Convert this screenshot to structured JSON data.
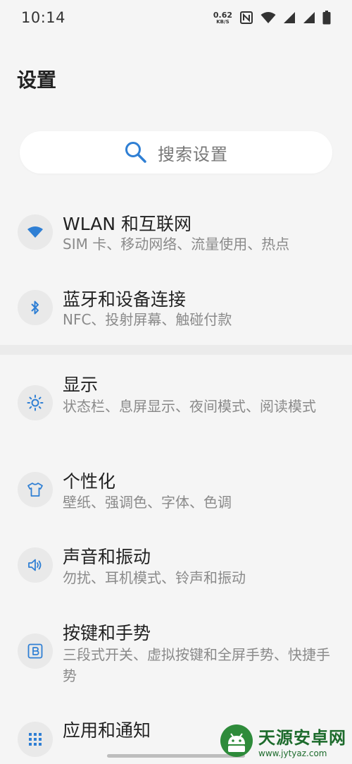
{
  "status_bar": {
    "time": "10:14",
    "net_speed_value": "0.62",
    "net_speed_unit": "KB/S",
    "icons": [
      "nfc-icon",
      "wifi-icon",
      "signal-icon",
      "signal-icon",
      "battery-icon"
    ]
  },
  "page": {
    "title": "设置"
  },
  "search": {
    "placeholder": "搜索设置"
  },
  "items": [
    {
      "title": "WLAN 和互联网",
      "subtitle": "SIM 卡、移动网络、流量使用、热点",
      "icon": "wifi-icon"
    },
    {
      "title": "蓝牙和设备连接",
      "subtitle": "NFC、投射屏幕、触碰付款",
      "icon": "bluetooth-icon"
    },
    {
      "title": "显示",
      "subtitle": "状态栏、息屏显示、夜间模式、阅读模式",
      "icon": "brightness-icon"
    },
    {
      "title": "个性化",
      "subtitle": "壁纸、强调色、字体、色调",
      "icon": "tshirt-icon"
    },
    {
      "title": "声音和振动",
      "subtitle": "勿扰、耳机模式、铃声和振动",
      "icon": "speaker-icon"
    },
    {
      "title": "按键和手势",
      "subtitle": "三段式开关、虚拟按键和全屏手势、快捷手势",
      "icon": "button-b-icon"
    },
    {
      "title": "应用和通知",
      "subtitle": "",
      "icon": "apps-grid-icon"
    }
  ],
  "watermark": {
    "title": "天源安卓网",
    "url": "www.jytyaz.com"
  },
  "colors": {
    "accent": "#2f7fd4",
    "background": "#f5f5f5",
    "icon_bg": "#e9e9e9",
    "watermark": "#1d6b2c"
  }
}
